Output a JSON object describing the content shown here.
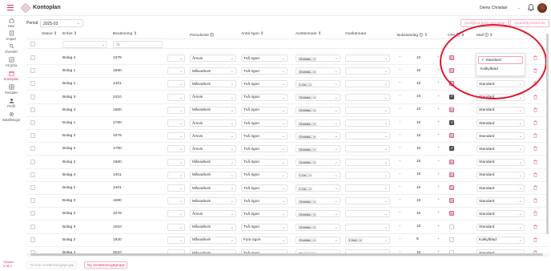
{
  "app": {
    "title": "Kontoplan"
  },
  "header": {
    "company": "Demo Christian"
  },
  "sidebar": {
    "items": [
      {
        "label": "Hem",
        "icon": "home-icon"
      },
      {
        "label": "Import",
        "icon": "import-icon"
      },
      {
        "label": "Översikt",
        "icon": "search-icon"
      },
      {
        "label": "Att göra",
        "icon": "checklist-icon"
      },
      {
        "label": "Kontoplan",
        "icon": "calendar-icon"
      },
      {
        "label": "Perioder",
        "icon": "grid-icon"
      },
      {
        "label": "Profil",
        "icon": "user-icon"
      },
      {
        "label": "Inställningar",
        "icon": "gear-icon"
      }
    ],
    "active": "Kontoplan",
    "version_label": "Version",
    "version_number": "0.96.1"
  },
  "period": {
    "label": "Period",
    "value": "2025-03"
  },
  "toolbar": {
    "btn1": "Redigera flera samtidigt",
    "btn2": "Visa/dölj kolumner"
  },
  "table": {
    "headers": {
      "status": "Status",
      "enhet": "Enhet",
      "benamning": "Benämning",
      "periodicitet": "Periodicitet",
      "antal_ogon": "Antal ögon",
      "avstammare": "Avstämmare",
      "godkannare": "Godkännare",
      "bokslutsdag": "Bokslutsdag",
      "cpa": "CPA",
      "mall": "Mall"
    },
    "rows": [
      {
        "enhet": "Bolag 4",
        "konto": "1079",
        "period": "Årsvis",
        "ogon": "Två ögon",
        "avst": "Christia...",
        "godk": "",
        "dag": "10",
        "cpa": "on",
        "mall": "Standard"
      },
      {
        "enhet": "Bolag 1",
        "konto": "1680",
        "period": "Månadsvis",
        "ogon": "Två ögon",
        "avst": "Christia...",
        "godk": "",
        "dag": "10",
        "cpa": "on",
        "mall": "Standard"
      },
      {
        "enhet": "Bolag 1",
        "konto": "1401",
        "period": "Månadsvis",
        "ogon": "Två ögon",
        "avst": "1 Lis...",
        "godk": "",
        "dag": "10",
        "cpa": "on",
        "mall": "Standard"
      },
      {
        "enhet": "Bolag 3",
        "konto": "2410",
        "period": "Årsvis",
        "ogon": "Två ögon",
        "avst": "Christia...",
        "godk": "",
        "dag": "10",
        "cpa": "dark",
        "mall": "Standard"
      },
      {
        "enhet": "Bolag 4",
        "konto": "1680",
        "period": "Månadsvis",
        "ogon": "Två ögon",
        "avst": "Christia...",
        "godk": "",
        "dag": "10",
        "cpa": "on",
        "mall": "Standard"
      },
      {
        "enhet": "Bolag 1",
        "konto": "1790",
        "period": "Årsvis",
        "ogon": "Två ögon",
        "avst": "Christia...",
        "godk": "",
        "dag": "10",
        "cpa": "dark",
        "mall": "Standard"
      },
      {
        "enhet": "Bolag 3",
        "konto": "1079",
        "period": "Årsvis",
        "ogon": "Två ögon",
        "avst": "Christia...",
        "godk": "",
        "dag": "10",
        "cpa": "on",
        "mall": "Standard"
      },
      {
        "enhet": "Bolag 2",
        "konto": "1790",
        "period": "Årsvis",
        "ogon": "Två ögon",
        "avst": "Christia...",
        "godk": "",
        "dag": "10",
        "cpa": "dark",
        "mall": "Standard"
      },
      {
        "enhet": "Bolag 2",
        "konto": "1680",
        "period": "Månadsvis",
        "ogon": "Två ögon",
        "avst": "Christia...",
        "godk": "",
        "dag": "10",
        "cpa": "on",
        "mall": "Standard"
      },
      {
        "enhet": "Bolag 4",
        "konto": "1401",
        "period": "Månadsvis",
        "ogon": "Två ögon",
        "avst": "1 Lis...",
        "godk": "",
        "dag": "10",
        "cpa": "on",
        "mall": "Standard"
      },
      {
        "enhet": "Bolag 2",
        "konto": "1401",
        "period": "Månadsvis",
        "ogon": "Två ögon",
        "avst": "1 Lis...",
        "godk": "",
        "dag": "10",
        "cpa": "on",
        "mall": "Standard"
      },
      {
        "enhet": "Bolag 3",
        "konto": "1680",
        "period": "Månadsvis",
        "ogon": "Två ögon",
        "avst": "Christia...",
        "godk": "",
        "dag": "10",
        "cpa": "on",
        "mall": "Standard"
      },
      {
        "enhet": "Bolag 2",
        "konto": "1079",
        "period": "Årsvis",
        "ogon": "Två ögon",
        "avst": "Christia...",
        "godk": "",
        "dag": "10",
        "cpa": "on",
        "mall": "Standard"
      },
      {
        "enhet": "Bolag 3",
        "konto": "1010",
        "period": "Månadsvis",
        "ogon": "Två ögon",
        "avst": "Christia...",
        "godk": "",
        "dag": "10",
        "cpa": "off",
        "mall": "Standard"
      },
      {
        "enhet": "Bolag 2",
        "konto": "1920",
        "period": "Månadsvis",
        "ogon": "Fyra ögon",
        "avst": "Christia...",
        "godk": "1 Kal...",
        "dag": "8",
        "cpa": "off",
        "mall": "Kalkylblad"
      },
      {
        "enhet": "Bolag 4",
        "konto": "2010",
        "period": "Månadsvis",
        "ogon": "Två ögon",
        "avst": "Christia...",
        "godk": "",
        "dag": "10",
        "cpa": "off",
        "mall": "Standard"
      }
    ]
  },
  "mall_dropdown": {
    "options": [
      "Standard",
      "Kalkylblad"
    ],
    "selected": "Standard"
  },
  "bottom": {
    "btn1": "Ta bort avstämningsgrupp",
    "btn2": "Ny avstämningsgrupp"
  },
  "colors": {
    "accent": "#d6336c",
    "annotation_circle": "#e0182d"
  }
}
